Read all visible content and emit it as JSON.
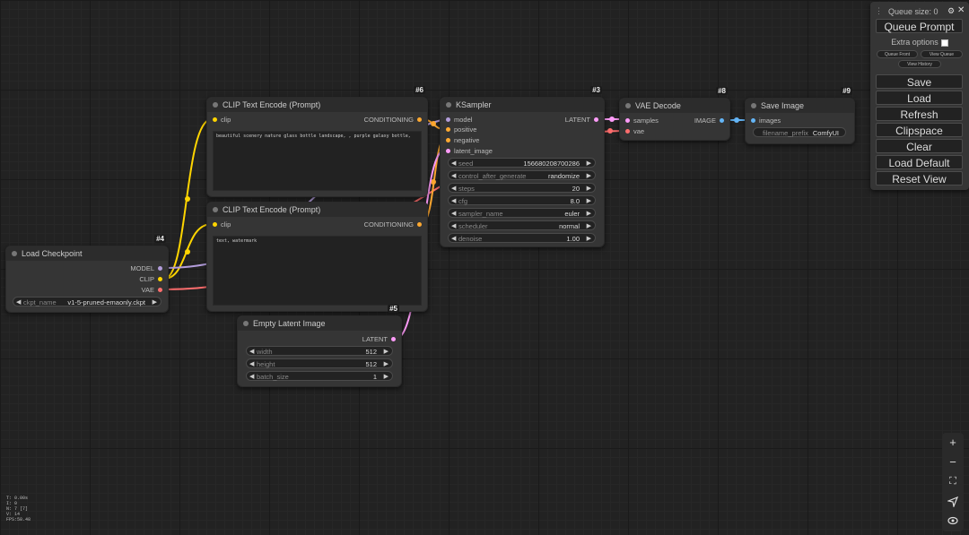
{
  "nodes": {
    "clip_pos": {
      "id": "#6",
      "title": "CLIP Text Encode (Prompt)",
      "input": "clip",
      "output": "CONDITIONING",
      "text": "beautiful scenery nature glass bottle landscape, , purple galaxy bottle,"
    },
    "clip_neg": {
      "id": "#7",
      "title": "CLIP Text Encode (Prompt)",
      "input": "clip",
      "output": "CONDITIONING",
      "text": "text, watermark"
    },
    "ksampler": {
      "id": "#3",
      "title": "KSampler",
      "inputs": [
        "model",
        "positive",
        "negative",
        "latent_image"
      ],
      "output": "LATENT",
      "widgets": [
        {
          "label": "seed",
          "value": "156680208700286"
        },
        {
          "label": "control_after_generate",
          "value": "randomize"
        },
        {
          "label": "steps",
          "value": "20"
        },
        {
          "label": "cfg",
          "value": "8.0"
        },
        {
          "label": "sampler_name",
          "value": "euler"
        },
        {
          "label": "scheduler",
          "value": "normal"
        },
        {
          "label": "denoise",
          "value": "1.00"
        }
      ]
    },
    "vae_decode": {
      "id": "#8",
      "title": "VAE Decode",
      "inputs": [
        "samples",
        "vae"
      ],
      "output": "IMAGE"
    },
    "save_image": {
      "id": "#9",
      "title": "Save Image",
      "input": "images",
      "widget": {
        "label": "filename_prefix",
        "value": "ComfyUI"
      }
    },
    "load_checkpoint": {
      "id": "#4",
      "title": "Load Checkpoint",
      "outputs": [
        "MODEL",
        "CLIP",
        "VAE"
      ],
      "widget": {
        "label": "ckpt_name",
        "value": "v1-5-pruned-emaonly.ckpt"
      }
    },
    "empty_latent": {
      "id": "#5",
      "title": "Empty Latent Image",
      "output": "LATENT",
      "widgets": [
        {
          "label": "width",
          "value": "512"
        },
        {
          "label": "height",
          "value": "512"
        },
        {
          "label": "batch_size",
          "value": "1"
        }
      ]
    }
  },
  "menu": {
    "queue_size": "Queue size: 0",
    "queue_prompt": "Queue Prompt",
    "extra_options": "Extra options",
    "queue_front": "Queue Front",
    "view_queue": "View Queue",
    "view_history": "View History",
    "save": "Save",
    "load": "Load",
    "refresh": "Refresh",
    "clipspace": "Clipspace",
    "clear": "Clear",
    "load_default": "Load Default",
    "reset_view": "Reset View"
  },
  "stats": [
    "T: 0.00s",
    "I: 0",
    "N: 7 [7]",
    "V: 14",
    "FPS:58.48"
  ],
  "colors": {
    "clip": "#FFD500",
    "conditioning": "#FFA931",
    "model": "#B39DDB",
    "latent": "#FF9CF9",
    "vae": "#FF6E6E",
    "image": "#64B5F6"
  },
  "icons": {
    "zoom_in": "plus-icon",
    "zoom_out": "minus-icon",
    "fit": "fit-view-icon",
    "pointer": "cursor-icon",
    "visibility": "eye-icon"
  }
}
